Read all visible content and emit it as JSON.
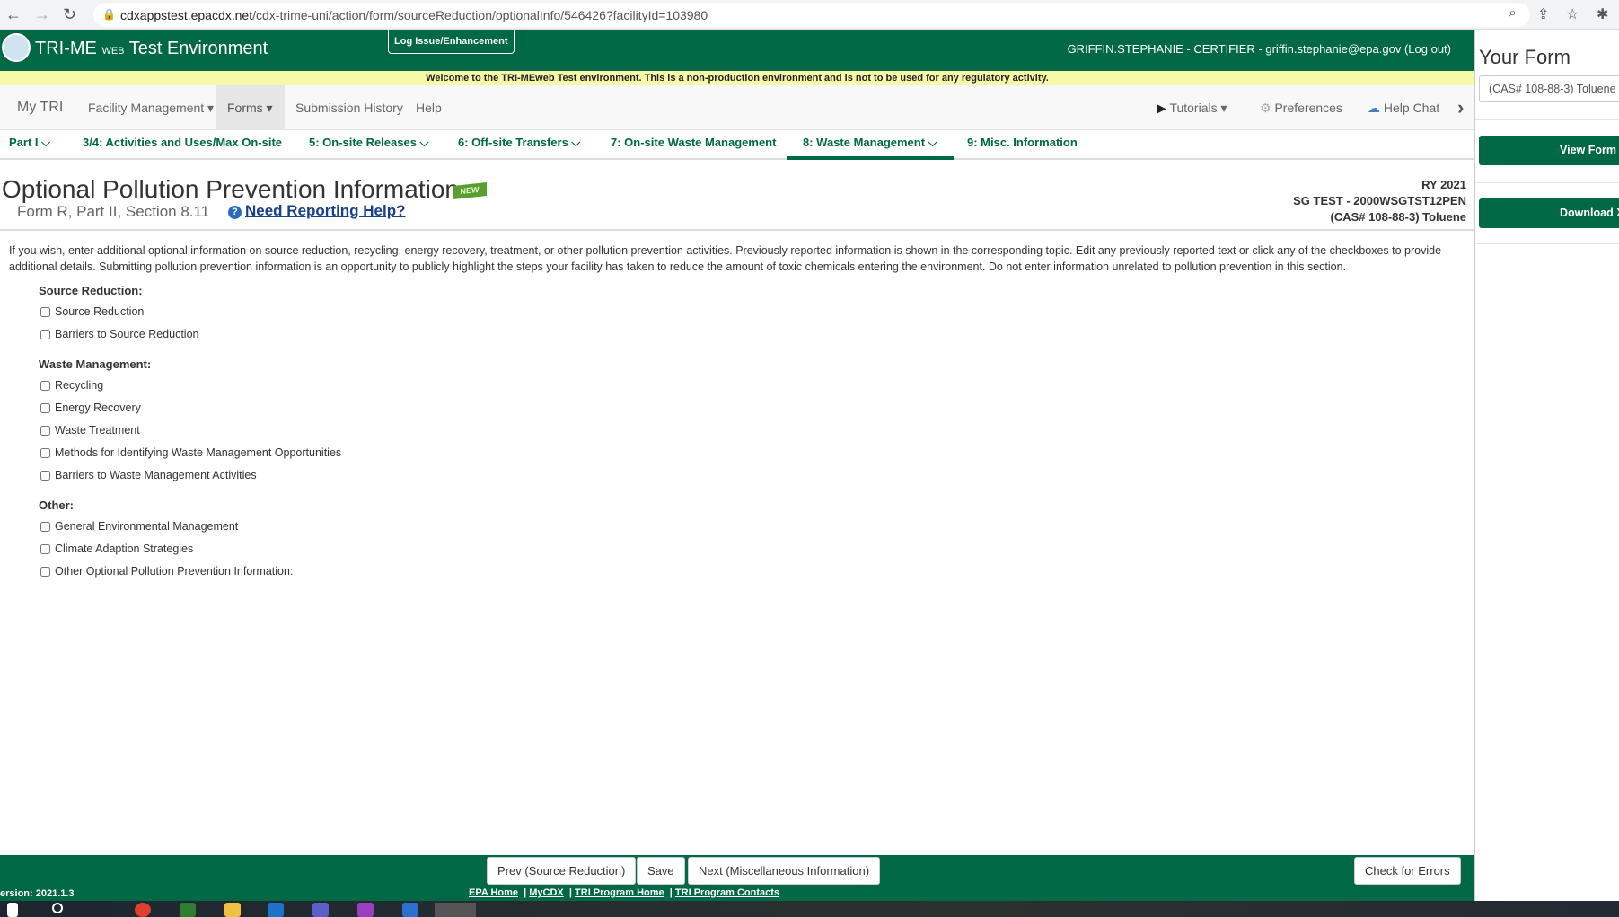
{
  "browser": {
    "url_host": "cdxappstest.epacdx.net",
    "url_path": "/cdx-trime-uni/action/form/sourceReduction/optionalInfo/546426?facilityId=103980"
  },
  "header": {
    "title_main": "TRI-ME",
    "title_small": "WEB",
    "title_env": "Test Environment",
    "log_issue": "Log Issue/Enhancement",
    "user": "GRIFFIN.STEPHANIE - CERTIFIER - griffin.stephanie@epa.gov (",
    "logout": "Log out",
    "user_end": ")"
  },
  "banner": "Welcome to the TRI-MEweb Test environment. This is a non-production environment and is not to be used for any regulatory activity.",
  "nav": {
    "items": [
      "My TRI",
      "Facility Management ▾",
      "Forms ▾",
      "Submission History",
      "Help"
    ],
    "tutorials": "Tutorials ▾",
    "preferences": "Preferences",
    "help_chat": "Help Chat"
  },
  "tabs": [
    "Part I ⌵",
    "3/4: Activities and Uses/Max On-site",
    "5: On-site Releases ⌵",
    "6: Off-site Transfers ⌵",
    "7: On-site Waste Management",
    "8: Waste Management ⌵",
    "9: Misc. Information"
  ],
  "page": {
    "title": "Optional Pollution Prevention Information",
    "badge": "NEW",
    "subtitle": "Form R, Part II, Section 8.11",
    "help_link": "Need Reporting Help?",
    "ry": "RY 2021",
    "facility": "SG TEST - 2000WSGTST12PEN",
    "chemical": "(CAS# 108-88-3) Toluene",
    "intro": "If you wish, enter additional optional information on source reduction, recycling, energy recovery, treatment, or other pollution prevention activities. Previously reported information is shown in the corresponding topic. Edit any previously reported text or click any of the checkboxes to provide additional details. Submitting pollution prevention information is an opportunity to publicly highlight the steps your facility has taken to reduce the amount of toxic chemicals entering the environment. Do not enter information unrelated to pollution prevention in this section."
  },
  "sections": [
    {
      "title": "Source Reduction:",
      "items": [
        "Source Reduction",
        "Barriers to Source Reduction"
      ]
    },
    {
      "title": "Waste Management:",
      "items": [
        "Recycling",
        "Energy Recovery",
        "Waste Treatment",
        "Methods for Identifying Waste Management Opportunities",
        "Barriers to Waste Management Activities"
      ]
    },
    {
      "title": "Other:",
      "items": [
        "General Environmental Management",
        "Climate Adaption Strategies",
        "Other Optional Pollution Prevention Information:"
      ]
    }
  ],
  "right": {
    "title": "Your Form",
    "select": "(CAS# 108-88-3) Toluene",
    "view": "View Form",
    "download": "Download X"
  },
  "footer": {
    "prev": "Prev (Source Reduction)",
    "save": "Save",
    "next": "Next (Miscellaneous Information)",
    "check": "Check for Errors",
    "version": "ersion: 2021.1.3",
    "links": [
      "EPA Home",
      "MyCDX",
      "TRI Program Home",
      "TRI Program Contacts"
    ]
  },
  "colors": {
    "brand_green": "#006845",
    "banner_yellow": "#f5f9a8"
  }
}
